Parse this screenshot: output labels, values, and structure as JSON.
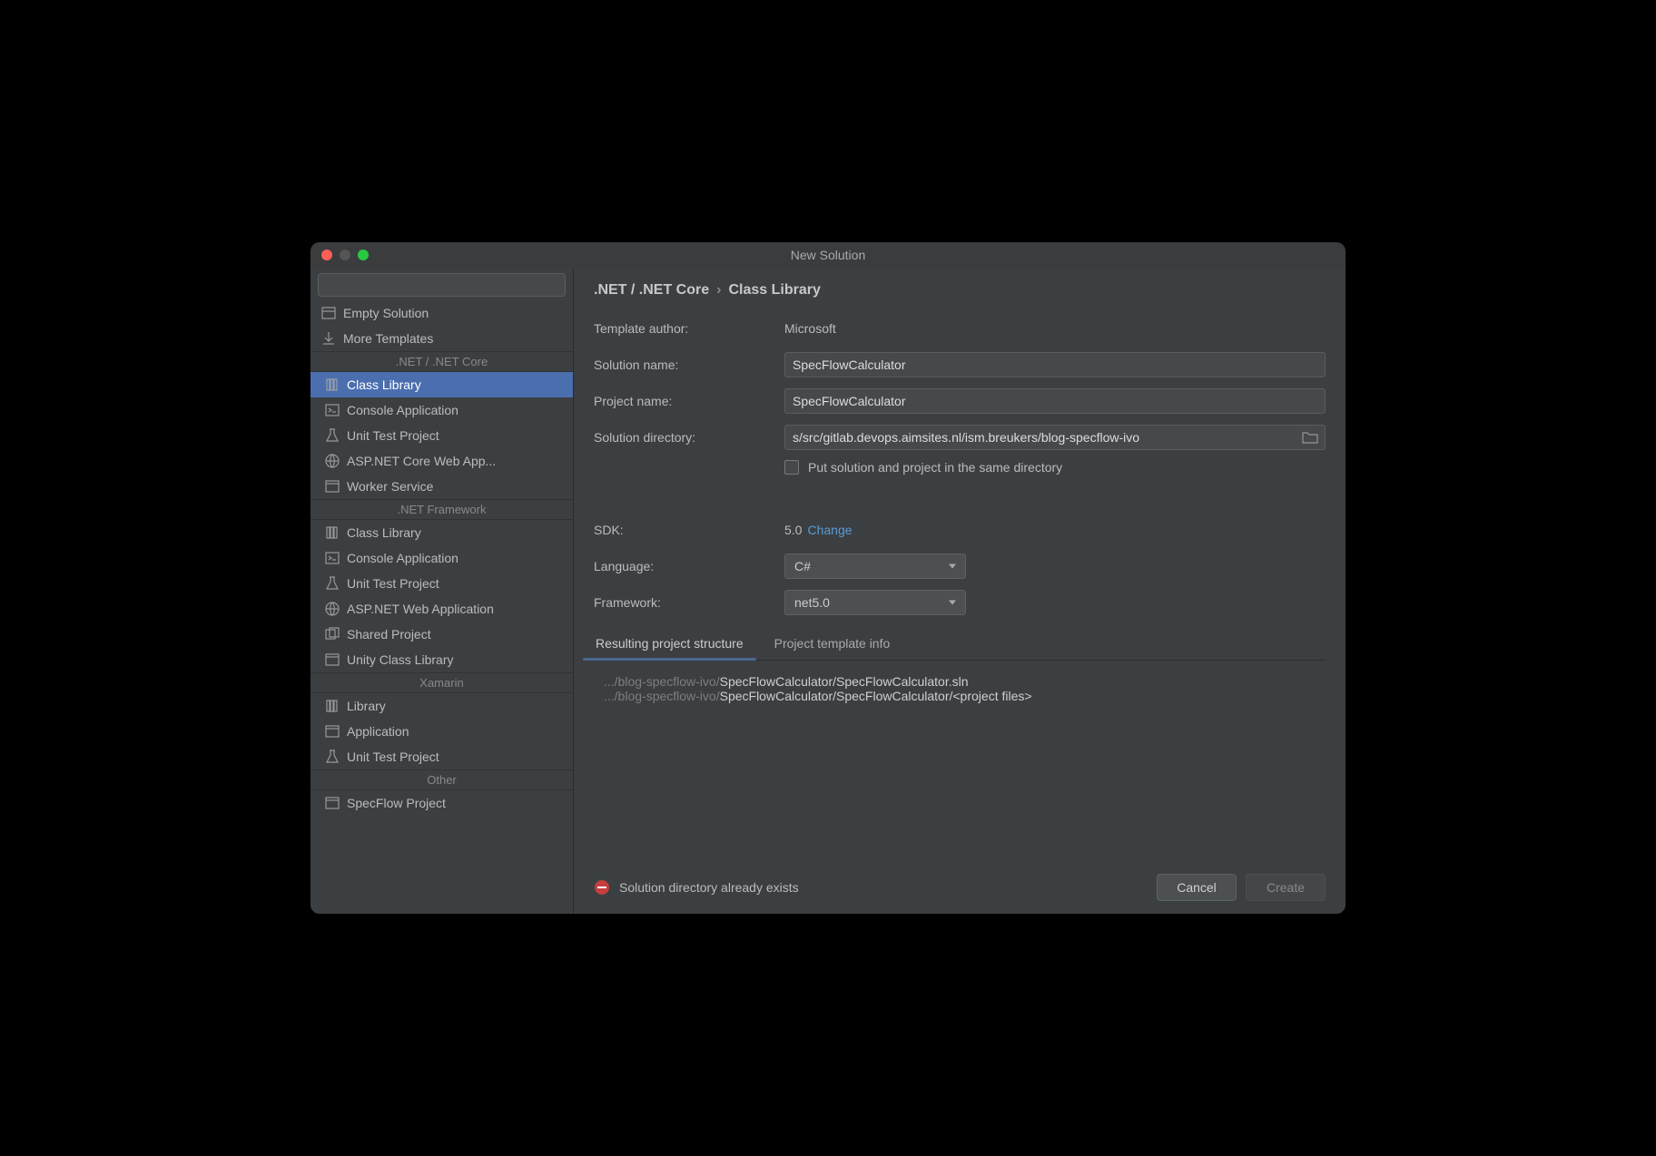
{
  "window": {
    "title": "New Solution"
  },
  "search": {
    "placeholder": ""
  },
  "sidebar": {
    "top": [
      {
        "label": "Empty Solution",
        "icon": "empty-solution"
      },
      {
        "label": "More Templates",
        "icon": "download"
      }
    ],
    "groups": [
      {
        "name": ".NET / .NET Core",
        "items": [
          {
            "label": "Class Library",
            "icon": "library",
            "selected": true
          },
          {
            "label": "Console Application",
            "icon": "console"
          },
          {
            "label": "Unit Test Project",
            "icon": "test"
          },
          {
            "label": "ASP.NET Core Web App...",
            "icon": "globe"
          },
          {
            "label": "Worker Service",
            "icon": "window"
          }
        ]
      },
      {
        "name": ".NET Framework",
        "items": [
          {
            "label": "Class Library",
            "icon": "library"
          },
          {
            "label": "Console Application",
            "icon": "console"
          },
          {
            "label": "Unit Test Project",
            "icon": "test"
          },
          {
            "label": "ASP.NET Web Application",
            "icon": "globe"
          },
          {
            "label": "Shared Project",
            "icon": "shared"
          },
          {
            "label": "Unity Class Library",
            "icon": "window"
          }
        ]
      },
      {
        "name": "Xamarin",
        "items": [
          {
            "label": "Library",
            "icon": "library"
          },
          {
            "label": "Application",
            "icon": "window"
          },
          {
            "label": "Unit Test Project",
            "icon": "test"
          }
        ]
      },
      {
        "name": "Other",
        "items": [
          {
            "label": "SpecFlow Project",
            "icon": "window"
          }
        ]
      }
    ]
  },
  "breadcrumb": {
    "parent": ".NET / .NET Core",
    "current": "Class Library"
  },
  "form": {
    "template_author_label": "Template author:",
    "template_author_value": "Microsoft",
    "solution_name_label": "Solution name:",
    "solution_name_value": "SpecFlowCalculator",
    "project_name_label": "Project name:",
    "project_name_value": "SpecFlowCalculator",
    "solution_dir_label": "Solution directory:",
    "solution_dir_value": "s/src/gitlab.devops.aimsites.nl/ism.breukers/blog-specflow-ivo",
    "same_dir_label": "Put solution and project in the same directory",
    "sdk_label": "SDK:",
    "sdk_value": "5.0",
    "sdk_change": "Change",
    "language_label": "Language:",
    "language_value": "C#",
    "framework_label": "Framework:",
    "framework_value": "net5.0"
  },
  "tabs": {
    "structure": "Resulting project structure",
    "info": "Project template info"
  },
  "result": {
    "line1_dim": ".../blog-specflow-ivo/",
    "line1_bright": "SpecFlowCalculator/SpecFlowCalculator.sln",
    "line2_dim": ".../blog-specflow-ivo/",
    "line2_bright": "SpecFlowCalculator/SpecFlowCalculator/<project files>"
  },
  "footer": {
    "warning": "Solution directory already exists",
    "cancel": "Cancel",
    "create": "Create"
  }
}
